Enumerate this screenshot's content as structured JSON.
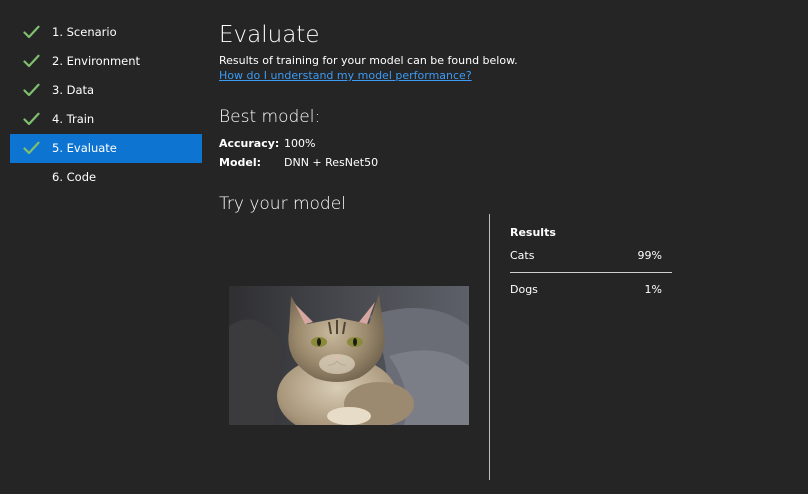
{
  "sidebar": {
    "steps": [
      {
        "label": "1. Scenario",
        "done": true
      },
      {
        "label": "2. Environment",
        "done": true
      },
      {
        "label": "3. Data",
        "done": true
      },
      {
        "label": "4. Train",
        "done": true
      },
      {
        "label": "5. Evaluate",
        "done": true,
        "active": true
      },
      {
        "label": "6. Code",
        "done": false
      }
    ]
  },
  "main": {
    "title": "Evaluate",
    "subtitle": "Results of training for your model can be found below.",
    "help_link": "How do I understand my model performance?",
    "best_model": {
      "heading": "Best model:",
      "accuracy_label": "Accuracy:",
      "accuracy_value": "100%",
      "model_label": "Model:",
      "model_value": "DNN + ResNet50"
    },
    "try_model": {
      "heading": "Try your model"
    },
    "results": {
      "heading": "Results",
      "rows": [
        {
          "label": "Cats",
          "value": "99%"
        },
        {
          "label": "Dogs",
          "value": "1%"
        }
      ]
    }
  },
  "colors": {
    "background": "#252526",
    "active_step": "#0e74d2",
    "check": "#7fbf6e",
    "link": "#3b9bf5"
  }
}
